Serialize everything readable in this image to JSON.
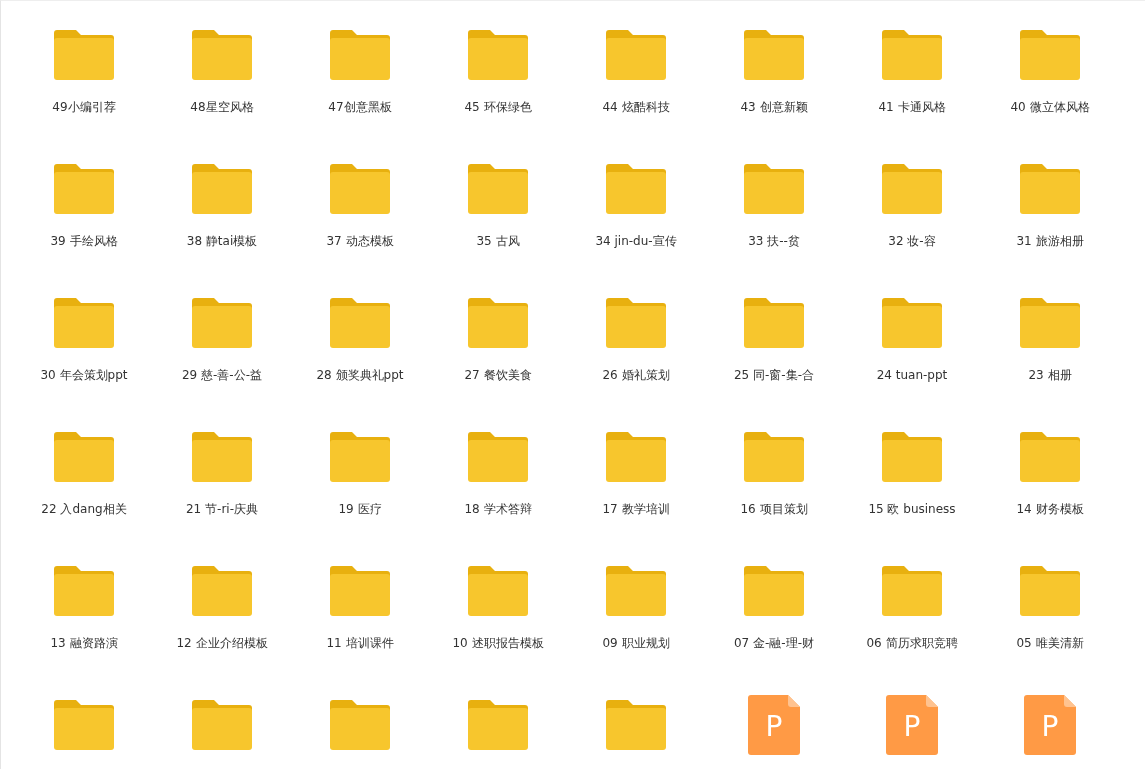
{
  "items": [
    {
      "kind": "folder",
      "name": "49小编引荐"
    },
    {
      "kind": "folder",
      "name": "48星空风格"
    },
    {
      "kind": "folder",
      "name": "47创意黑板"
    },
    {
      "kind": "folder",
      "name": "45 环保绿色"
    },
    {
      "kind": "folder",
      "name": "44 炫酷科技"
    },
    {
      "kind": "folder",
      "name": "43 创意新颖"
    },
    {
      "kind": "folder",
      "name": "41 卡通风格"
    },
    {
      "kind": "folder",
      "name": "40 微立体风格"
    },
    {
      "kind": "folder",
      "name": "39 手绘风格"
    },
    {
      "kind": "folder",
      "name": "38 静tai模板"
    },
    {
      "kind": "folder",
      "name": "37 动态模板"
    },
    {
      "kind": "folder",
      "name": "35 古风"
    },
    {
      "kind": "folder",
      "name": "34 jin-du-宣传"
    },
    {
      "kind": "folder",
      "name": "33 扶--贫"
    },
    {
      "kind": "folder",
      "name": "32 妆-容"
    },
    {
      "kind": "folder",
      "name": "31 旅游相册"
    },
    {
      "kind": "folder",
      "name": "30 年会策划ppt"
    },
    {
      "kind": "folder",
      "name": "29 慈-善-公-益"
    },
    {
      "kind": "folder",
      "name": "28 颁奖典礼ppt"
    },
    {
      "kind": "folder",
      "name": "27 餐饮美食"
    },
    {
      "kind": "folder",
      "name": "26 婚礼策划"
    },
    {
      "kind": "folder",
      "name": "25 同-窗-集-合"
    },
    {
      "kind": "folder",
      "name": "24 tuan-ppt"
    },
    {
      "kind": "folder",
      "name": "23 相册"
    },
    {
      "kind": "folder",
      "name": "22 入dang相关"
    },
    {
      "kind": "folder",
      "name": "21 节-ri-庆典"
    },
    {
      "kind": "folder",
      "name": "19 医疗"
    },
    {
      "kind": "folder",
      "name": "18 学术答辩"
    },
    {
      "kind": "folder",
      "name": "17 教学培训"
    },
    {
      "kind": "folder",
      "name": "16 项目策划"
    },
    {
      "kind": "folder",
      "name": "15 欧 business"
    },
    {
      "kind": "folder",
      "name": "14 财务模板"
    },
    {
      "kind": "folder",
      "name": "13 融资路演"
    },
    {
      "kind": "folder",
      "name": "12 企业介绍模板"
    },
    {
      "kind": "folder",
      "name": "11 培训课件"
    },
    {
      "kind": "folder",
      "name": "10 述职报告模板"
    },
    {
      "kind": "folder",
      "name": "09 职业规划"
    },
    {
      "kind": "folder",
      "name": "07 金-融-理-财"
    },
    {
      "kind": "folder",
      "name": "06 简历求职竞聘"
    },
    {
      "kind": "folder",
      "name": "05 唯美清新"
    },
    {
      "kind": "folder"
    },
    {
      "kind": "folder"
    },
    {
      "kind": "folder"
    },
    {
      "kind": "folder"
    },
    {
      "kind": "folder"
    },
    {
      "kind": "ppt",
      "icon_letter": "P"
    },
    {
      "kind": "ppt",
      "icon_letter": "P"
    },
    {
      "kind": "ppt",
      "icon_letter": "P"
    }
  ]
}
